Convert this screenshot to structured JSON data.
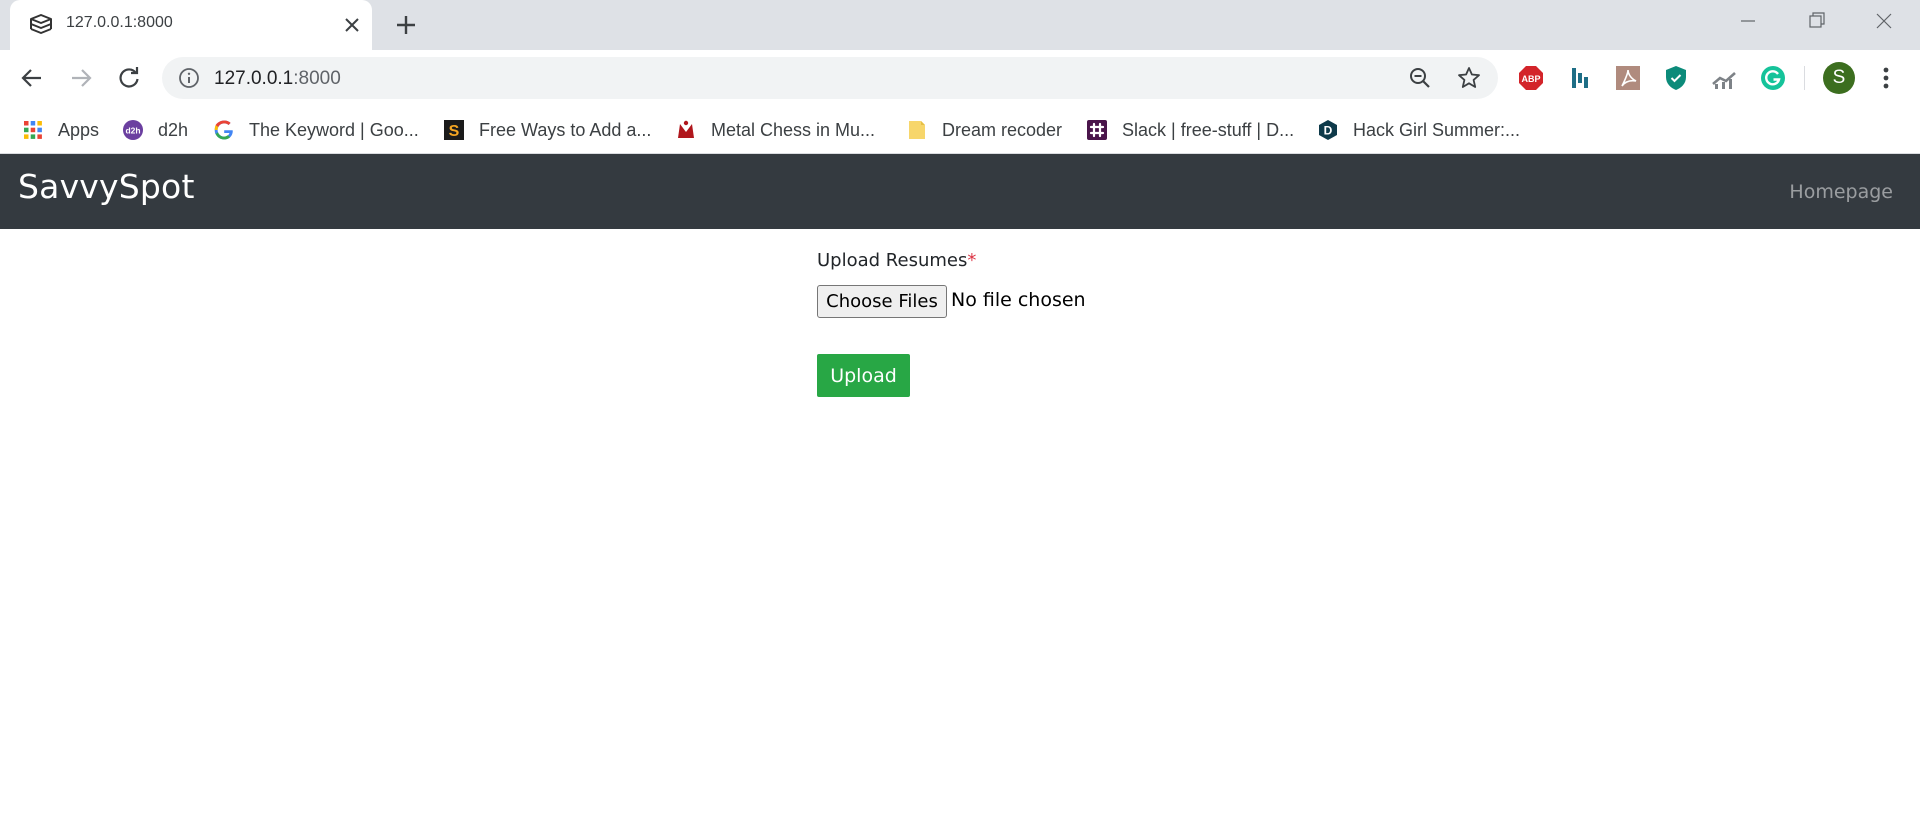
{
  "browser": {
    "tab": {
      "title": "127.0.0.1:8000",
      "favicon": "savvyspot-logo-icon"
    },
    "url": {
      "host": "127.0.0.1",
      "port": ":8000"
    },
    "profile_initial": "S",
    "extensions": [
      "adblock-plus-icon",
      "bar-chart-extension-icon",
      "pdf-extension-icon",
      "shield-extension-icon",
      "analytics-extension-icon",
      "grammarly-icon"
    ],
    "extension_labels": {
      "adblock": "ABP"
    },
    "colors": {
      "tabstrip": "#dee1e6",
      "omnibox": "#f1f3f4",
      "avatar": "#3c6e1f"
    }
  },
  "bookmarks": [
    {
      "label": "Apps",
      "icon": "apps-grid-icon"
    },
    {
      "label": "d2h",
      "icon": "d2h-icon"
    },
    {
      "label": "The Keyword | Goo...",
      "icon": "google-icon"
    },
    {
      "label": "Free Ways to Add a...",
      "icon": "s-logo-icon"
    },
    {
      "label": "Metal Chess in Mu...",
      "icon": "chess-icon"
    },
    {
      "label": "Dream recoder",
      "icon": "note-icon"
    },
    {
      "label": "Slack | free-stuff | D...",
      "icon": "slack-icon"
    },
    {
      "label": "Hack Girl Summer:...",
      "icon": "d-logo-icon"
    }
  ],
  "site": {
    "brand": "SavvySpot",
    "nav_link": "Homepage",
    "colors": {
      "navbar": "#343a40",
      "button": "#28a745",
      "required": "#dc3545"
    }
  },
  "form": {
    "label": "Upload Resumes",
    "required_mark": "*",
    "choose_button": "Choose Files",
    "file_status": "No file chosen",
    "submit": "Upload"
  }
}
